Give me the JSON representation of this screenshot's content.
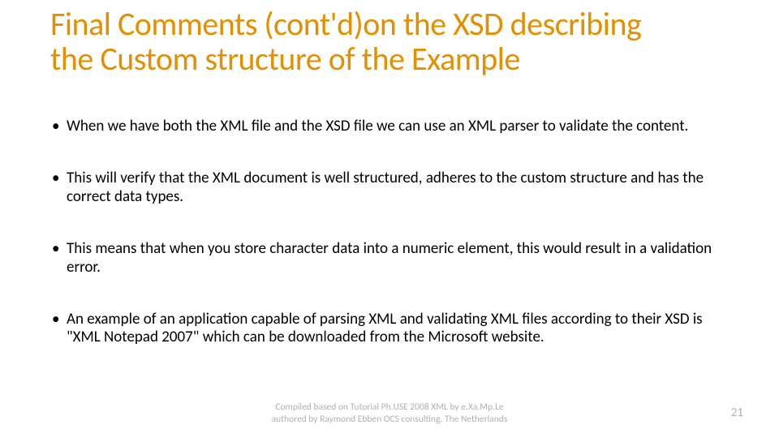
{
  "title": "Final Comments (cont'd)on the XSD describing the Custom structure of the Example",
  "bullets": [
    "When we have both the XML file and the XSD file we can use an XML parser to validate the content.",
    "This will verify that the XML document is well structured, adheres to the custom structure and has the correct data types.",
    "This means that when you store character data into a numeric element, this would result in a validation error.",
    "An example of an application capable of parsing XML and validating XML files according to their XSD is \"XML Notepad 2007\" which can be downloaded from the Microsoft website."
  ],
  "footer": {
    "line1": "Compiled based on Tutorial Ph.USE 2008 XML by e.Xa.Mp.Le",
    "line2": "authored by Raymond Ebben OCS consulting, The Netherlands"
  },
  "page_number": "21"
}
